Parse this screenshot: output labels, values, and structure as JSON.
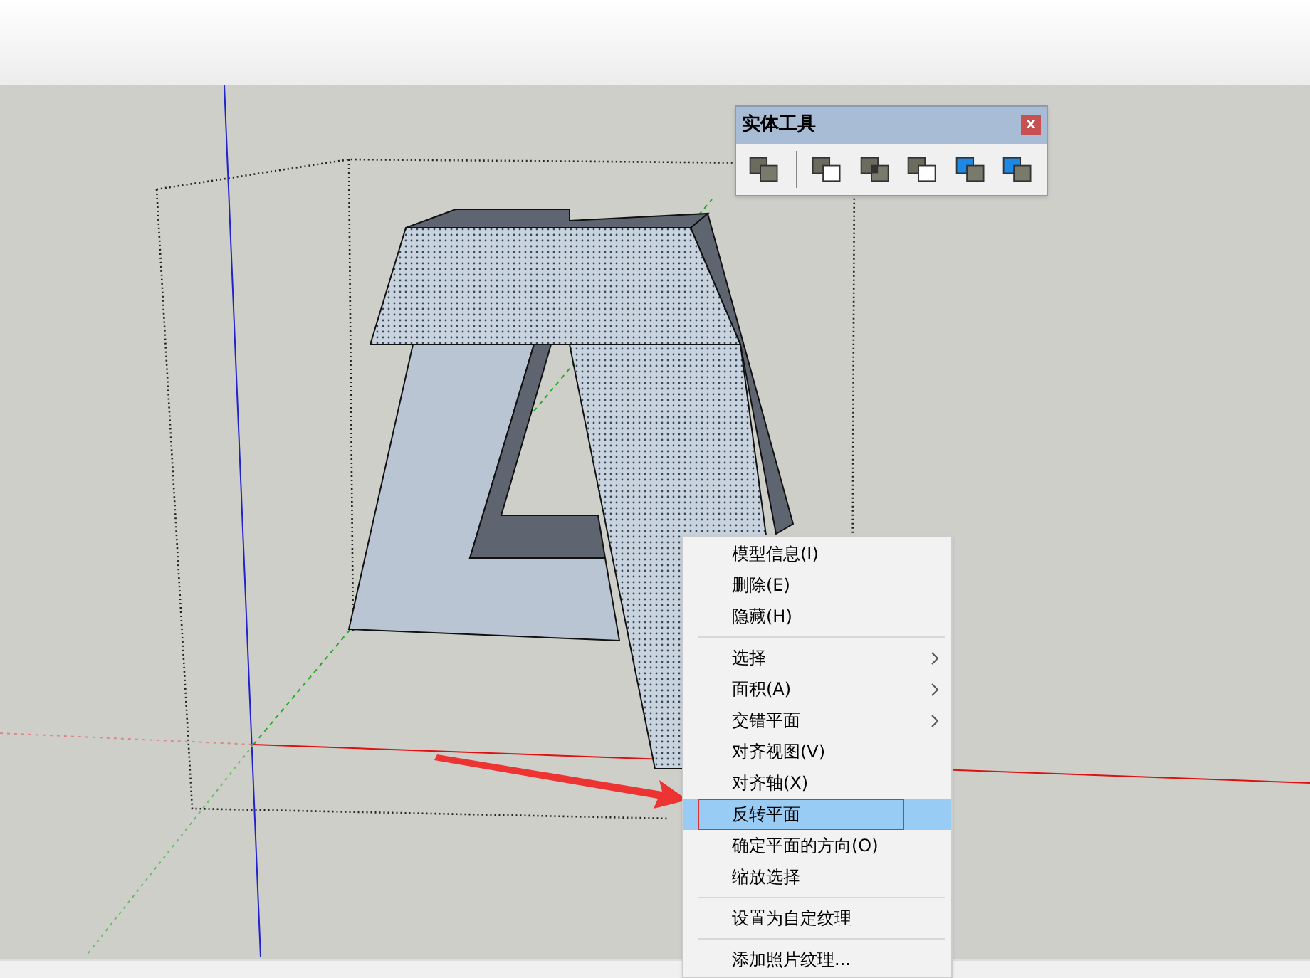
{
  "toolbar": {
    "title": "实体工具",
    "close": "x"
  },
  "context_menu": {
    "items": [
      {
        "kind": "item",
        "label": "模型信息(I)",
        "submenu": false,
        "selected": false
      },
      {
        "kind": "item",
        "label": "删除(E)",
        "submenu": false,
        "selected": false
      },
      {
        "kind": "item",
        "label": "隐藏(H)",
        "submenu": false,
        "selected": false
      },
      {
        "kind": "separator"
      },
      {
        "kind": "item",
        "label": "选择",
        "submenu": true,
        "selected": false
      },
      {
        "kind": "item",
        "label": "面积(A)",
        "submenu": true,
        "selected": false
      },
      {
        "kind": "item",
        "label": "交错平面",
        "submenu": true,
        "selected": false
      },
      {
        "kind": "item",
        "label": "对齐视图(V)",
        "submenu": false,
        "selected": false
      },
      {
        "kind": "item",
        "label": "对齐轴(X)",
        "submenu": false,
        "selected": false
      },
      {
        "kind": "item",
        "label": "反转平面",
        "submenu": false,
        "selected": true
      },
      {
        "kind": "item",
        "label": "确定平面的方向(O)",
        "submenu": false,
        "selected": false
      },
      {
        "kind": "item",
        "label": "缩放选择",
        "submenu": false,
        "selected": false
      },
      {
        "kind": "separator"
      },
      {
        "kind": "item",
        "label": "设置为自定纹理",
        "submenu": false,
        "selected": false
      },
      {
        "kind": "separator"
      },
      {
        "kind": "item",
        "label": "添加照片纹理...",
        "submenu": false,
        "selected": false
      }
    ]
  }
}
